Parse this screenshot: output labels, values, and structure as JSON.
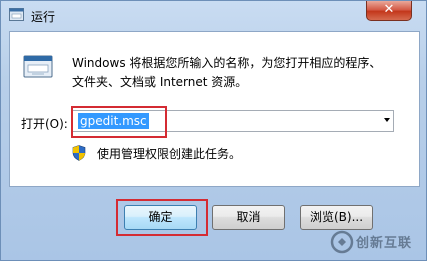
{
  "window": {
    "title": "运行",
    "close_label": "✕"
  },
  "dialog": {
    "description_line1": "Windows 将根据您所输入的名称，为您打开相应的程序、",
    "description_line2": "文件夹、文档或 Internet 资源。",
    "open_label": "打开(O):",
    "open_value": "gpedit.msc",
    "admin_note": "使用管理权限创建此任务。"
  },
  "buttons": {
    "ok": "确定",
    "cancel": "取消",
    "browse": "浏览(B)..."
  },
  "watermark": {
    "text": "创新互联"
  },
  "icons": [
    "run-app-icon",
    "run-program-icon",
    "uac-shield-icon",
    "dropdown-arrow-icon",
    "close-icon",
    "watermark-logo-icon"
  ]
}
